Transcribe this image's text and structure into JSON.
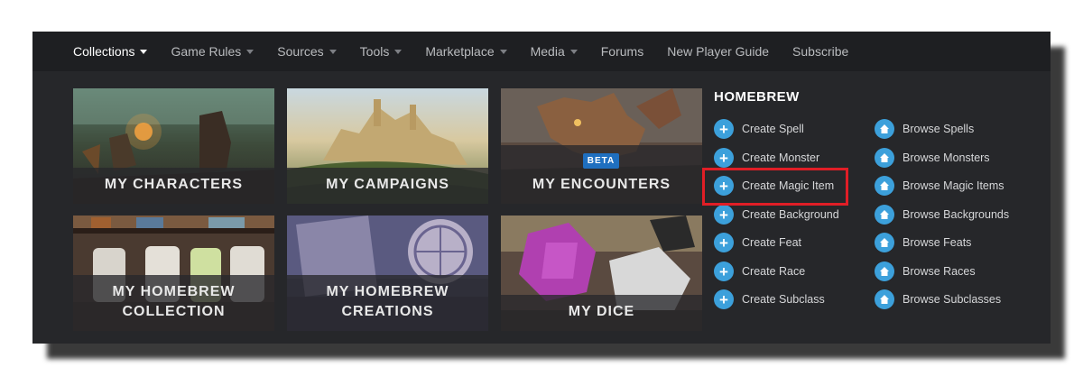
{
  "nav": {
    "items": [
      {
        "label": "Collections",
        "dropdown": true,
        "active": true
      },
      {
        "label": "Game Rules",
        "dropdown": true
      },
      {
        "label": "Sources",
        "dropdown": true
      },
      {
        "label": "Tools",
        "dropdown": true
      },
      {
        "label": "Marketplace",
        "dropdown": true
      },
      {
        "label": "Media",
        "dropdown": true
      },
      {
        "label": "Forums",
        "dropdown": false
      },
      {
        "label": "New Player Guide",
        "dropdown": false
      },
      {
        "label": "Subscribe",
        "dropdown": false
      }
    ]
  },
  "tiles": {
    "characters": {
      "label": "MY CHARACTERS"
    },
    "campaigns": {
      "label": "MY CAMPAIGNS"
    },
    "encounters": {
      "label": "MY ENCOUNTERS",
      "badge": "BETA"
    },
    "homebrew_collection": {
      "line1": "MY HOMEBREW",
      "line2": "COLLECTION"
    },
    "homebrew_creations": {
      "line1": "MY HOMEBREW",
      "line2": "CREATIONS"
    },
    "dice": {
      "label": "MY DICE"
    }
  },
  "homebrew": {
    "title": "HOMEBREW",
    "create": [
      {
        "label": "Create Spell",
        "icon": "plus-icon"
      },
      {
        "label": "Create Monster",
        "icon": "plus-icon"
      },
      {
        "label": "Create Magic Item",
        "icon": "plus-icon",
        "highlighted": true
      },
      {
        "label": "Create Background",
        "icon": "plus-icon"
      },
      {
        "label": "Create Feat",
        "icon": "plus-icon"
      },
      {
        "label": "Create Race",
        "icon": "plus-icon"
      },
      {
        "label": "Create Subclass",
        "icon": "plus-icon"
      }
    ],
    "browse": [
      {
        "label": "Browse Spells",
        "icon": "home-icon"
      },
      {
        "label": "Browse Monsters",
        "icon": "home-icon"
      },
      {
        "label": "Browse Magic Items",
        "icon": "home-icon"
      },
      {
        "label": "Browse Backgrounds",
        "icon": "home-icon"
      },
      {
        "label": "Browse Feats",
        "icon": "home-icon"
      },
      {
        "label": "Browse Races",
        "icon": "home-icon"
      },
      {
        "label": "Browse Subclasses",
        "icon": "home-icon"
      }
    ]
  },
  "colors": {
    "accent_blue": "#3ca0db",
    "highlight_red": "#e01e26",
    "beta_blue": "#1f6fbf"
  }
}
